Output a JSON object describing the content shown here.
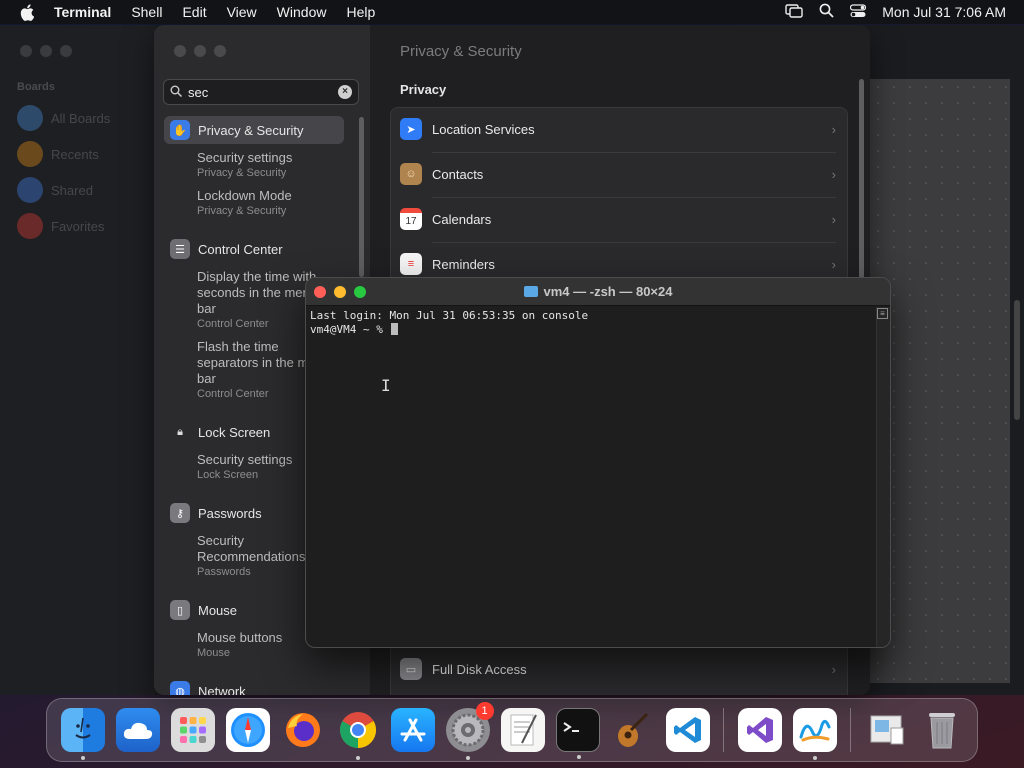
{
  "menubar": {
    "app_name": "Terminal",
    "items": [
      "Shell",
      "Edit",
      "View",
      "Window",
      "Help"
    ],
    "clock": "Mon Jul 31  7:06 AM"
  },
  "background_window": {
    "sidebar_header": "Boards",
    "items": [
      {
        "label": "All Boards",
        "color": "#2d4a6a"
      },
      {
        "label": "Recents",
        "color": "#6a4a1c"
      },
      {
        "label": "Shared",
        "color": "#2b4470"
      },
      {
        "label": "Favorites",
        "color": "#6a2a2a"
      }
    ]
  },
  "settings": {
    "search": {
      "value": "sec"
    },
    "sidebar": {
      "privacy": {
        "label": "Privacy & Security",
        "icon": "hand-icon"
      },
      "privacy_results": [
        {
          "title": "Security settings",
          "subtitle": "Privacy & Security"
        },
        {
          "title": "Lockdown Mode",
          "subtitle": "Privacy & Security"
        }
      ],
      "control_center": {
        "label": "Control Center",
        "icon": "toggles-icon"
      },
      "control_results": [
        {
          "title": "Display the time with seconds in the menu bar",
          "subtitle": "Control Center"
        },
        {
          "title": "Flash the time separators in the menu bar",
          "subtitle": "Control Center"
        }
      ],
      "lock_screen": {
        "label": "Lock Screen",
        "icon": "lock-icon"
      },
      "lock_results": [
        {
          "title": "Security settings",
          "subtitle": "Lock Screen"
        }
      ],
      "passwords": {
        "label": "Passwords",
        "icon": "key-icon"
      },
      "password_results": [
        {
          "title": "Security Recommendations",
          "subtitle": "Passwords"
        }
      ],
      "mouse": {
        "label": "Mouse",
        "icon": "mouse-icon"
      },
      "mouse_results": [
        {
          "title": "Mouse buttons",
          "subtitle": "Mouse"
        }
      ],
      "network": {
        "label": "Network",
        "icon": "globe-icon"
      }
    },
    "main": {
      "title": "Privacy & Security",
      "section": "Privacy",
      "rows": [
        {
          "label": "Location Services",
          "icon": "location-arrow-icon"
        },
        {
          "label": "Contacts",
          "icon": "contacts-icon"
        },
        {
          "label": "Calendars",
          "icon": "calendar-icon",
          "icon_text": "17"
        },
        {
          "label": "Reminders",
          "icon": "reminders-icon"
        },
        {
          "label": "Full Disk Access",
          "icon": "disk-icon"
        }
      ]
    }
  },
  "terminal": {
    "title": "vm4 — -zsh — 80×24",
    "lines": [
      "Last login: Mon Jul 31 06:53:35 on console",
      "vm4@VM4 ~ % "
    ]
  },
  "dock": {
    "apps": [
      {
        "name": "Finder",
        "icon": "finder-icon",
        "running": true
      },
      {
        "name": "iCloud",
        "icon": "cloud-icon",
        "running": false
      },
      {
        "name": "Launchpad",
        "icon": "launchpad-icon",
        "running": false
      },
      {
        "name": "Safari",
        "icon": "safari-icon",
        "running": false
      },
      {
        "name": "Firefox",
        "icon": "firefox-icon",
        "running": false
      },
      {
        "name": "Chrome",
        "icon": "chrome-icon",
        "running": true
      },
      {
        "name": "App Store",
        "icon": "appstore-icon",
        "running": false
      },
      {
        "name": "System Settings",
        "icon": "settings-gear-icon",
        "running": true,
        "badge": "1"
      },
      {
        "name": "TextEdit",
        "icon": "textedit-icon",
        "running": false
      },
      {
        "name": "Terminal",
        "icon": "terminal-icon",
        "running": true
      },
      {
        "name": "GarageBand",
        "icon": "guitar-icon",
        "running": false
      },
      {
        "name": "VS Code",
        "icon": "vscode-icon",
        "running": false
      },
      {
        "name": "Visual Studio",
        "icon": "visualstudio-icon",
        "running": false
      },
      {
        "name": "Freeform",
        "icon": "freeform-icon",
        "running": true
      },
      {
        "name": "Preview",
        "icon": "preview-icon",
        "running": false
      },
      {
        "name": "Trash",
        "icon": "trash-icon",
        "running": false
      }
    ]
  }
}
